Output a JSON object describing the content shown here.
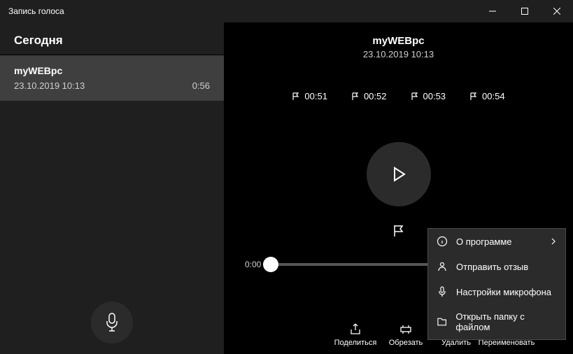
{
  "app": {
    "title": "Запись голоса"
  },
  "sidebar": {
    "section": "Сегодня",
    "items": [
      {
        "title": "myWEBpc",
        "datetime": "23.10.2019 10:13",
        "duration": "0:56"
      }
    ]
  },
  "nowplaying": {
    "title": "myWEBpc",
    "datetime": "23.10.2019 10:13"
  },
  "markers": [
    "00:51",
    "00:52",
    "00:53",
    "00:54"
  ],
  "timeline": {
    "current": "0:00"
  },
  "actions": {
    "share": "Поделиться",
    "trim": "Обрезать",
    "delete": "Удалить",
    "rename": "Переименовать"
  },
  "menu": {
    "about": "О программе",
    "feedback": "Отправить отзыв",
    "mic_settings": "Настройки микрофона",
    "open_folder": "Открыть папку с файлом"
  }
}
